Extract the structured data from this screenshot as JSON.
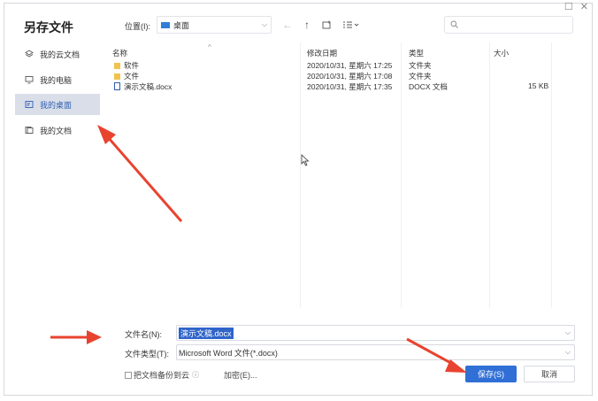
{
  "dialog": {
    "title": "另存文件"
  },
  "sidebar": {
    "items": [
      {
        "label": "我的云文档",
        "icon": "cloud-doc-icon"
      },
      {
        "label": "我的电脑",
        "icon": "computer-icon"
      },
      {
        "label": "我的桌面",
        "icon": "desktop-icon",
        "active": true
      },
      {
        "label": "我的文档",
        "icon": "documents-icon"
      }
    ]
  },
  "toolbar": {
    "location_label": "位置(I):",
    "location_value": "桌面",
    "search_placeholder": ""
  },
  "file_list": {
    "headers": [
      "名称",
      "修改日期",
      "类型",
      "大小"
    ],
    "rows": [
      {
        "name": "软件",
        "date": "2020/10/31, 星期六 17:25",
        "type": "文件夹",
        "size": "",
        "icon": "folder-icon"
      },
      {
        "name": "文件",
        "date": "2020/10/31, 星期六 17:08",
        "type": "文件夹",
        "size": "",
        "icon": "folder-icon"
      },
      {
        "name": "演示文稿.docx",
        "date": "2020/10/31, 星期六 17:35",
        "type": "DOCX 文档",
        "size": "15 KB",
        "icon": "docx-icon"
      }
    ]
  },
  "form": {
    "filename_label": "文件名(N):",
    "filename_value": "演示文稿.docx",
    "filetype_label": "文件类型(T):",
    "filetype_value": "Microsoft Word 文件(*.docx)",
    "backup_label": "把文档备份到云",
    "encrypt_label": "加密(E)...",
    "save_label": "保存(S)",
    "cancel_label": "取消"
  },
  "colors": {
    "accent": "#2f6fd6",
    "annotation_arrow": "#e8432f",
    "sidebar_active_bg": "#d9dee8"
  }
}
